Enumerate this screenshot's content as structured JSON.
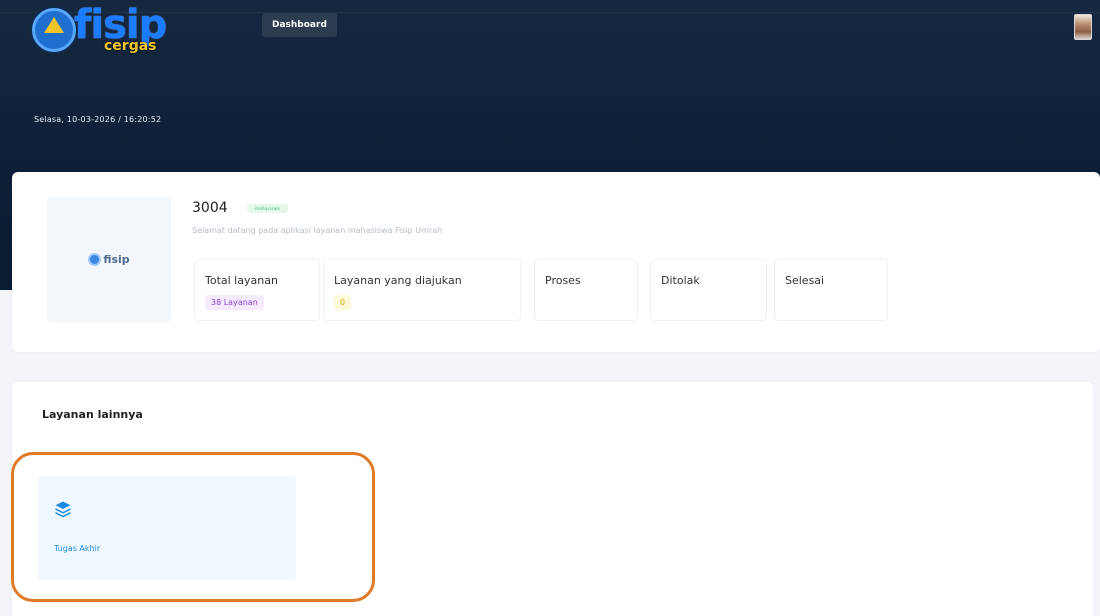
{
  "header": {
    "logo_text": "fisip",
    "logo_sub": "cergas",
    "nav_label": "Dashboard",
    "datetime": "Selasa, 10-03-2026 / 16:20:52"
  },
  "profile": {
    "id": "3004",
    "role_badge": "mahasiswa",
    "welcome": "Selamat datang pada aplikasi layanan mahasiswa Fisip Umrah",
    "logo_text": "fisip",
    "stats": [
      {
        "label": "Total layanan",
        "value": "38 Layanan"
      },
      {
        "label": "Layanan yang diajukan",
        "value": "0"
      },
      {
        "label": "Proses",
        "value": ""
      },
      {
        "label": "Ditolak",
        "value": ""
      },
      {
        "label": "Selesai",
        "value": ""
      }
    ]
  },
  "services": {
    "title": "Layanan lainnya",
    "items": [
      {
        "label": "Tugas Akhir",
        "icon": "layers-icon"
      }
    ]
  },
  "colors": {
    "header_bg": "#0d2037",
    "accent_blue": "#1e88e5",
    "highlight": "#e07a26",
    "badge_green": "#39b56a",
    "chip_purple": "#8e44d2",
    "chip_yellow": "#d7a600"
  }
}
